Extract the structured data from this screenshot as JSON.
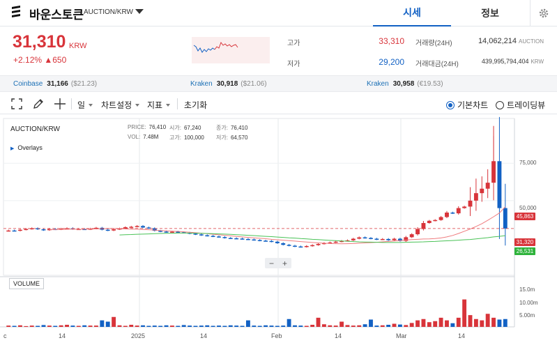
{
  "header": {
    "coin_name": "바운스토큰",
    "pair": "AUCTION/KRW",
    "tabs": [
      {
        "label": "시세",
        "active": true
      },
      {
        "label": "정보",
        "active": false
      }
    ],
    "icons": {
      "logo": "stacked-bars-logo",
      "settings": "gear-icon",
      "dropdown": "caret-down-icon"
    }
  },
  "price": {
    "current": "31,310",
    "unit": "KRW",
    "change_text": "+2.12% ▲650",
    "color_up": "#d8343a",
    "color_down": "#1261c4"
  },
  "stats": {
    "high_label": "고가",
    "high": "33,310",
    "low_label": "저가",
    "low": "29,200",
    "volume_label": "거래량(24H)",
    "volume": "14,062,214",
    "volume_unit": "AUCTION",
    "amount_label": "거래대금(24H)",
    "amount": "439,995,794,404",
    "amount_unit": "KRW"
  },
  "exchanges": [
    {
      "name": "Coinbase",
      "price": "31,166",
      "sub": "($21.23)"
    },
    {
      "name": "Kraken",
      "price": "30,918",
      "sub": "($21.06)"
    },
    {
      "name": "Kraken",
      "price": "30,958",
      "sub": "(€19.53)"
    }
  ],
  "toolbar": {
    "icons": [
      "fullscreen-icon",
      "pencil-icon",
      "crosshair-icon"
    ],
    "interval": "일",
    "chart_settings": "차트설정",
    "indicators": "지표",
    "reset": "초기화",
    "view_basic": "기본차트",
    "view_trading": "트레이딩뷰",
    "selected_view": "기본차트"
  },
  "chart_header": {
    "symbol": "AUCTION/KRW",
    "overlays": "Overlays",
    "price_label": "PRICE:",
    "price": "76,410",
    "open_label": "시가:",
    "open": "67,240",
    "close_label": "종가:",
    "close": "76,410",
    "vol_label": "VOL:",
    "vol": "7.48M",
    "high_label": "고가:",
    "high": "100,000",
    "low_label": "저가:",
    "low": "64,570",
    "volume_title": "VOLUME"
  },
  "badges": {
    "high": "45,863",
    "last": "31,320",
    "ma": "26,531"
  },
  "y_axis_price": [
    "75,000",
    "50,000"
  ],
  "y_axis_volume": [
    "15.0m",
    "10.00m",
    "5.00m"
  ],
  "x_axis": [
    "c",
    "14",
    "2025",
    "14",
    "Feb",
    "14",
    "Mar",
    "14"
  ],
  "chart_data": {
    "type": "candlestick",
    "ylim": [
      0,
      105000
    ],
    "last_price": 31320,
    "dashed_line": 31320,
    "series": [
      {
        "name": "close",
        "values": [
          30000,
          29800,
          30500,
          31000,
          31500,
          30800,
          30200,
          31000,
          30700,
          31200,
          31500,
          30900,
          31000,
          30800,
          31200,
          31800,
          30500,
          30000,
          30800,
          31300,
          32200,
          32500,
          33000,
          32000,
          31500,
          29800,
          29300,
          29000,
          29200,
          28800,
          28500,
          27900,
          27400,
          26800,
          26400,
          26000,
          25600,
          25000,
          24800,
          24600,
          24300,
          24000,
          23600,
          23200,
          23000,
          22500,
          21500,
          20400,
          19800,
          19300,
          19000,
          19600,
          20200,
          21000,
          21600,
          22000,
          22500,
          23000,
          23400,
          24500,
          25400,
          25000,
          24500,
          24000,
          24300,
          23500,
          24500,
          23000,
          25500,
          27500,
          31000,
          35000,
          36500,
          37000,
          39000,
          42000,
          41500,
          45000,
          46000,
          50000,
          55000,
          58000,
          62000,
          76410,
          45000,
          31320
        ]
      },
      {
        "name": "MA-short",
        "values": [
          30500,
          30600,
          30700,
          30800,
          30900,
          30800,
          30900,
          31000,
          31100,
          31200,
          31300,
          31300,
          31200,
          31100,
          31000,
          30900,
          30700,
          30500,
          30300,
          30000,
          29800,
          29600,
          29400,
          29100,
          28800,
          28500,
          28200,
          27900,
          27500,
          27100,
          26800,
          26400,
          26000,
          25700,
          25400,
          25100,
          24800,
          24500,
          24100,
          23800,
          23500,
          23200,
          22900,
          22600,
          22300,
          22000,
          21700,
          21500,
          21300,
          21200,
          21100,
          21200,
          21300,
          21500,
          21700,
          21900,
          22100,
          22400,
          22700,
          23000,
          23300,
          23600,
          23900,
          24100,
          24300,
          24400,
          24600,
          25000,
          25700,
          26700,
          28000,
          29500,
          31000,
          32700,
          34600,
          36800,
          39200,
          41700,
          45863
        ]
      },
      {
        "name": "MA-long",
        "values": [
          27000,
          27200,
          27300,
          27500,
          27600,
          27700,
          27900,
          28000,
          28100,
          28200,
          28300,
          28300,
          28300,
          28200,
          28100,
          28000,
          27900,
          27700,
          27600,
          27400,
          27200,
          27000,
          26800,
          26600,
          26300,
          26100,
          25900,
          25600,
          25400,
          25100,
          24900,
          24600,
          24400,
          24100,
          23900,
          23600,
          23400,
          23200,
          23000,
          22800,
          22600,
          22400,
          22300,
          22200,
          22100,
          22000,
          22000,
          22000,
          22000,
          22100,
          22200,
          22300,
          22400,
          22600,
          22700,
          22900,
          23100,
          23300,
          23500,
          23800,
          24000,
          24400,
          24800,
          25200,
          25700,
          26100,
          26531
        ]
      }
    ],
    "volume_m": [
      0.5,
      0.4,
      0.6,
      0.3,
      0.5,
      0.4,
      0.7,
      0.5,
      0.4,
      0.6,
      0.8,
      0.5,
      0.4,
      0.6,
      0.5,
      0.5,
      2.5,
      2.0,
      3.8,
      0.6,
      0.4,
      0.8,
      0.5,
      0.6,
      0.4,
      0.5,
      0.4,
      0.6,
      0.5,
      0.4,
      0.7,
      0.5,
      0.4,
      0.5,
      0.6,
      0.4,
      0.5,
      0.4,
      0.6,
      0.5,
      0.4,
      2.5,
      0.5,
      0.4,
      0.6,
      0.5,
      0.4,
      0.5,
      3.0,
      0.6,
      0.5,
      0.4,
      0.8,
      3.5,
      1.0,
      0.6,
      0.5,
      2.0,
      0.7,
      0.5,
      0.6,
      1.0,
      2.8,
      0.5,
      0.6,
      0.8,
      1.2,
      0.9,
      0.7,
      1.5,
      2.5,
      3.0,
      1.8,
      2.2,
      3.5,
      2.5,
      1.4,
      3.5,
      10.5,
      4.5,
      3.0,
      2.5,
      5.0,
      3.5,
      2.8,
      3.0,
      8.5,
      14.0,
      15.0,
      9.5
    ]
  }
}
